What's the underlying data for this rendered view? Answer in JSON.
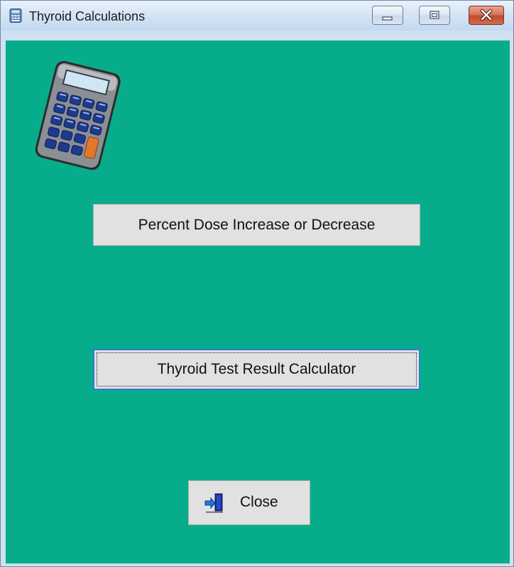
{
  "window": {
    "title": "Thyroid Calculations",
    "app_icon": "calculator-app-icon",
    "controls": {
      "minimize_icon": "minimize-icon",
      "maximize_icon": "maximize-icon",
      "close_icon": "close-window-icon"
    }
  },
  "colors": {
    "background": "#07ad8a",
    "button_face": "#e1e1e1",
    "focus_border": "#2f7ad6"
  },
  "main": {
    "logo_icon": "calculator-icon",
    "percent_dose_label": "Percent Dose Increase or Decrease",
    "thyroid_test_label": "Thyroid Test Result Calculator",
    "close_label": "Close",
    "close_icon": "exit-door-icon"
  }
}
